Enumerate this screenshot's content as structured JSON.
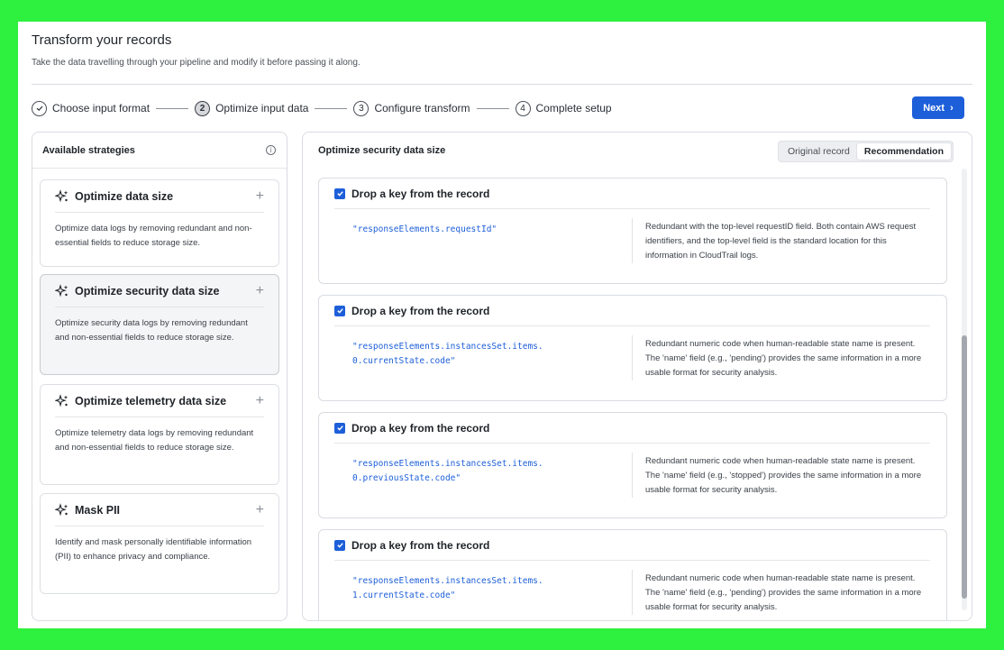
{
  "page": {
    "title": "Transform your records",
    "subtitle": "Take the data travelling through your pipeline and modify it before passing it along."
  },
  "stepper": {
    "steps": [
      {
        "marker": "✓",
        "label": "Choose input format",
        "state": "done"
      },
      {
        "marker": "2",
        "label": "Optimize input data",
        "state": "active"
      },
      {
        "marker": "3",
        "label": "Configure transform",
        "state": "pending"
      },
      {
        "marker": "4",
        "label": "Complete setup",
        "state": "pending"
      }
    ],
    "next_label": "Next",
    "next_icon": "›"
  },
  "strategies": {
    "header": "Available strategies",
    "info_icon": "i",
    "items": [
      {
        "title": "Optimize data size",
        "description": "Optimize data logs by removing redundant and non-essential fields to reduce storage size."
      },
      {
        "title": "Optimize security data size",
        "description": "Optimize security data logs by removing redundant and non-essential fields to reduce storage size."
      },
      {
        "title": "Optimize telemetry data size",
        "description": "Optimize telemetry data logs by removing redundant and non-essential fields to reduce storage size."
      },
      {
        "title": "Mask PII",
        "description": "Identify and mask personally identifiable information (PII) to enhance privacy and compliance."
      }
    ],
    "plus_icon": "+"
  },
  "recommendation": {
    "header": "Optimize security data size",
    "toggle": {
      "original": "Original record",
      "recommendation": "Recommendation",
      "selected": "Recommendation"
    },
    "records": [
      {
        "action": "Drop a key from the record",
        "checked": true,
        "key": "\"responseElements.requestId\"",
        "reason": "Redundant with the top-level requestID field. Both contain AWS request identifiers, and the top-level field is the standard location for this information in CloudTrail logs."
      },
      {
        "action": "Drop a key from the record",
        "checked": true,
        "key": "\"responseElements.instancesSet.items.0.currentState.code\"",
        "reason": "Redundant numeric code when human-readable state name is present. The 'name' field (e.g., 'pending') provides the same information in a more usable format for security analysis."
      },
      {
        "action": "Drop a key from the record",
        "checked": true,
        "key": "\"responseElements.instancesSet.items.0.previousState.code\"",
        "reason": "Redundant numeric code when human-readable state name is present. The 'name' field (e.g., 'stopped') provides the same information in a more usable format for security analysis."
      },
      {
        "action": "Drop a key from the record",
        "checked": true,
        "key": "\"responseElements.instancesSet.items.1.currentState.code\"",
        "reason": "Redundant numeric code when human-readable state name is present. The 'name' field (e.g., 'pending') provides the same information in a more usable format for security analysis."
      }
    ]
  },
  "colors": {
    "accent": "#1d5fd9",
    "frame": "#2ef03f"
  }
}
